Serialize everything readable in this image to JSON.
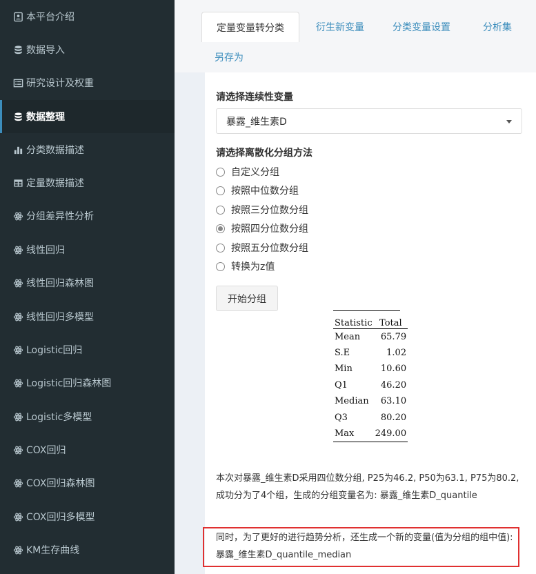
{
  "sidebar": {
    "items": [
      {
        "label": "本平台介绍",
        "icon": "id-card-icon",
        "active": false
      },
      {
        "label": "数据导入",
        "icon": "database-icon",
        "active": false
      },
      {
        "label": "研究设计及权重",
        "icon": "list-alt-icon",
        "active": false
      },
      {
        "label": "数据整理",
        "icon": "database-icon",
        "active": true
      },
      {
        "label": "分类数据描述",
        "icon": "bar-chart-icon",
        "active": false
      },
      {
        "label": "定量数据描述",
        "icon": "table-icon",
        "active": false
      },
      {
        "label": "分组差异性分析",
        "icon": "atom-icon",
        "active": false
      },
      {
        "label": "线性回归",
        "icon": "atom-icon",
        "active": false
      },
      {
        "label": "线性回归森林图",
        "icon": "atom-icon",
        "active": false
      },
      {
        "label": "线性回归多模型",
        "icon": "atom-icon",
        "active": false
      },
      {
        "label": "Logistic回归",
        "icon": "atom-icon",
        "active": false
      },
      {
        "label": "Logistic回归森林图",
        "icon": "atom-icon",
        "active": false
      },
      {
        "label": "Logistic多模型",
        "icon": "atom-icon",
        "active": false
      },
      {
        "label": "COX回归",
        "icon": "atom-icon",
        "active": false
      },
      {
        "label": "COX回归森林图",
        "icon": "atom-icon",
        "active": false
      },
      {
        "label": "COX回归多模型",
        "icon": "atom-icon",
        "active": false
      },
      {
        "label": "KM生存曲线",
        "icon": "atom-icon",
        "active": false
      }
    ]
  },
  "tabs": [
    "定量变量转分类",
    "衍生新变量",
    "分类变量设置",
    "分析集",
    "另存为"
  ],
  "form": {
    "variable_label": "请选择连续性变量",
    "variable_value": "暴露_维生素D",
    "method_label": "请选择离散化分组方法",
    "methods": [
      {
        "label": "自定义分组",
        "checked": false
      },
      {
        "label": "按照中位数分组",
        "checked": false
      },
      {
        "label": "按照三分位数分组",
        "checked": false
      },
      {
        "label": "按照四分位数分组",
        "checked": true
      },
      {
        "label": "按照五分位数分组",
        "checked": false
      },
      {
        "label": "转换为z值",
        "checked": false
      }
    ],
    "start_button": "开始分组"
  },
  "stats": {
    "header": [
      "Statistic",
      "Total"
    ],
    "rows": [
      [
        "Mean",
        "65.79"
      ],
      [
        "S.E",
        "1.02"
      ],
      [
        "Min",
        "10.60"
      ],
      [
        "Q1",
        "46.20"
      ],
      [
        "Median",
        "63.10"
      ],
      [
        "Q3",
        "80.20"
      ],
      [
        "Max",
        "249.00"
      ]
    ]
  },
  "result_text": "本次对暴露_维生素D采用四位数分组, P25为46.2, P50为63.1, P75为80.2, 成功分为了4个组，生成的分组变量名为: 暴露_维生素D_quantile",
  "note_text": "同时，为了更好的进行趋势分析，还生成一个新的变量(值为分组的组中值):暴露_维生素D_quantile_median",
  "colors": {
    "sidebar_bg": "#222d32",
    "accent": "#3c8dbc",
    "highlight": "#e03030"
  }
}
